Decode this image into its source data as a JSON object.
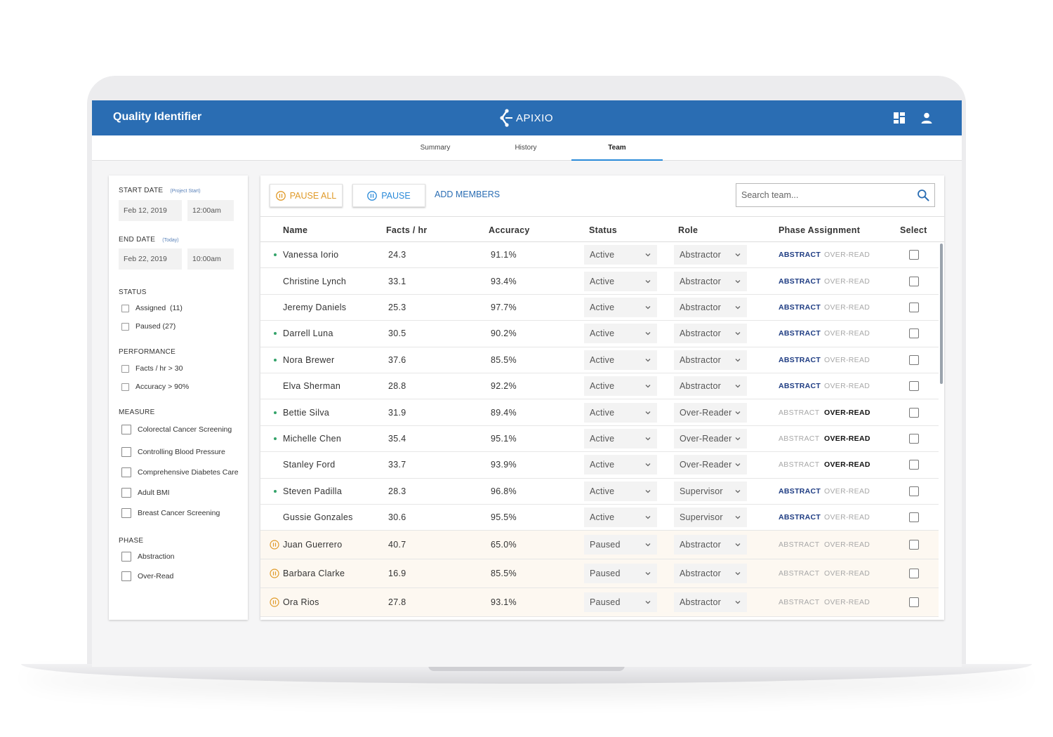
{
  "header": {
    "title": "Quality Identifier",
    "brand": "APIXIO"
  },
  "tabs": [
    "Summary",
    "History",
    "Team"
  ],
  "active_tab": "Team",
  "filters": {
    "start_date": {
      "label": "START DATE",
      "note": "(Project Start)",
      "date": "Feb 12, 2019",
      "time": "12:00am"
    },
    "end_date": {
      "label": "END DATE",
      "note": "(Today)",
      "date": "Feb 22, 2019",
      "time": "10:00am"
    },
    "status": {
      "label": "STATUS",
      "items": [
        "Assigned  (11)",
        "Paused (27)"
      ]
    },
    "performance": {
      "label": "PERFORMANCE",
      "items": [
        "Facts / hr > 30",
        "Accuracy > 90%"
      ]
    },
    "measure": {
      "label": "MEASURE",
      "items": [
        "Colorectal Cancer Screening",
        "Controlling Blood Pressure",
        "Comprehensive Diabetes Care",
        "Adult BMI",
        "Breast Cancer Screening"
      ]
    },
    "phase": {
      "label": "PHASE",
      "items": [
        "Abstraction",
        "Over-Read"
      ]
    }
  },
  "toolbar": {
    "pause_all": "PAUSE ALL",
    "pause": "PAUSE",
    "add_members": "ADD MEMBERS",
    "search_placeholder": "Search team..."
  },
  "table": {
    "headers": [
      "Name",
      "Facts / hr",
      "Accuracy",
      "Status",
      "Role",
      "Phase Assignment",
      "Select"
    ],
    "phase_labels": [
      "ABSTRACT",
      "OVER-READ"
    ],
    "rows": [
      {
        "name": "Vanessa Iorio",
        "facts": "24.3",
        "accuracy": "91.1%",
        "status": "Active",
        "role": "Abstractor",
        "phase": "abstract",
        "indicator": "dot"
      },
      {
        "name": "Christine Lynch",
        "facts": "33.1",
        "accuracy": "93.4%",
        "status": "Active",
        "role": "Abstractor",
        "phase": "abstract",
        "indicator": "none"
      },
      {
        "name": "Jeremy Daniels",
        "facts": "25.3",
        "accuracy": "97.7%",
        "status": "Active",
        "role": "Abstractor",
        "phase": "abstract",
        "indicator": "none"
      },
      {
        "name": "Darrell Luna",
        "facts": "30.5",
        "accuracy": "90.2%",
        "status": "Active",
        "role": "Abstractor",
        "phase": "abstract",
        "indicator": "dot"
      },
      {
        "name": "Nora Brewer",
        "facts": "37.6",
        "accuracy": "85.5%",
        "status": "Active",
        "role": "Abstractor",
        "phase": "abstract",
        "indicator": "dot"
      },
      {
        "name": "Elva Sherman",
        "facts": "28.8",
        "accuracy": "92.2%",
        "status": "Active",
        "role": "Abstractor",
        "phase": "abstract",
        "indicator": "none"
      },
      {
        "name": "Bettie Silva",
        "facts": "31.9",
        "accuracy": "89.4%",
        "status": "Active",
        "role": "Over-Reader",
        "phase": "overread",
        "indicator": "dot"
      },
      {
        "name": "Michelle Chen",
        "facts": "35.4",
        "accuracy": "95.1%",
        "status": "Active",
        "role": "Over-Reader",
        "phase": "overread",
        "indicator": "dot"
      },
      {
        "name": "Stanley Ford",
        "facts": "33.7",
        "accuracy": "93.9%",
        "status": "Active",
        "role": "Over-Reader",
        "phase": "overread",
        "indicator": "none"
      },
      {
        "name": "Steven Padilla",
        "facts": "28.3",
        "accuracy": "96.8%",
        "status": "Active",
        "role": "Supervisor",
        "phase": "abstract",
        "indicator": "dot"
      },
      {
        "name": "Gussie Gonzales",
        "facts": "30.6",
        "accuracy": "95.5%",
        "status": "Active",
        "role": "Supervisor",
        "phase": "abstract",
        "indicator": "none"
      },
      {
        "name": "Juan Guerrero",
        "facts": "40.7",
        "accuracy": "65.0%",
        "status": "Paused",
        "role": "Abstractor",
        "phase": "none",
        "indicator": "paused"
      },
      {
        "name": "Barbara Clarke",
        "facts": "16.9",
        "accuracy": "85.5%",
        "status": "Paused",
        "role": "Abstractor",
        "phase": "none",
        "indicator": "paused"
      },
      {
        "name": "Ora Rios",
        "facts": "27.8",
        "accuracy": "93.1%",
        "status": "Paused",
        "role": "Abstractor",
        "phase": "none",
        "indicator": "paused"
      }
    ]
  },
  "colors": {
    "header": "#2a6db3",
    "accent": "#2a8ad9",
    "pause": "#e09a28",
    "active_dot": "#34a36a",
    "paused_row": "#fdf8f1"
  }
}
